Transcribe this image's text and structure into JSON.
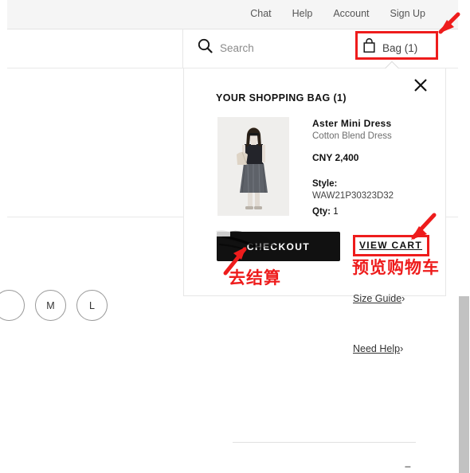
{
  "topnav": {
    "items": [
      {
        "label": "Chat",
        "name": "nav-chat"
      },
      {
        "label": "Help",
        "name": "nav-help"
      },
      {
        "label": "Account",
        "name": "nav-account"
      },
      {
        "label": "Sign Up",
        "name": "nav-sign-up"
      }
    ]
  },
  "search": {
    "placeholder": "Search",
    "icon": "search-icon"
  },
  "bag": {
    "label": "Bag (1)",
    "icon": "shopping-bag-icon",
    "count": 1
  },
  "bag_panel": {
    "title": "YOUR SHOPPING BAG (1)",
    "close_icon": "close-icon",
    "item": {
      "name": "Aster Mini Dress",
      "subtitle": "Cotton Blend Dress",
      "price": "CNY 2,400",
      "style_label": "Style:",
      "style_value": "WAW21P30323D32",
      "qty_label": "Qty:",
      "qty_value": "1",
      "thumbnail_alt": "model-wearing-aster-mini-dress"
    },
    "checkout_label": "CHECKOUT",
    "view_cart_label": "VIEW CART"
  },
  "product_page": {
    "sizes": [
      {
        "label": "",
        "name": "size-chip-s-partial"
      },
      {
        "label": "M",
        "name": "size-chip-m"
      },
      {
        "label": "L",
        "name": "size-chip-l"
      }
    ],
    "size_guide_label": "Size Guide",
    "need_help_label": "Need Help",
    "chevron": "›",
    "dash_mark": "–"
  },
  "annotations": {
    "highlight_color": "#ee1c1c",
    "checkout_cn": "去结算",
    "view_cart_cn": "预览购物车",
    "boxes": [
      "bag-button-highlight",
      "view-cart-highlight"
    ],
    "arrows": [
      "arrow-to-bag-button",
      "arrow-to-checkout-button",
      "arrow-to-view-cart"
    ]
  }
}
